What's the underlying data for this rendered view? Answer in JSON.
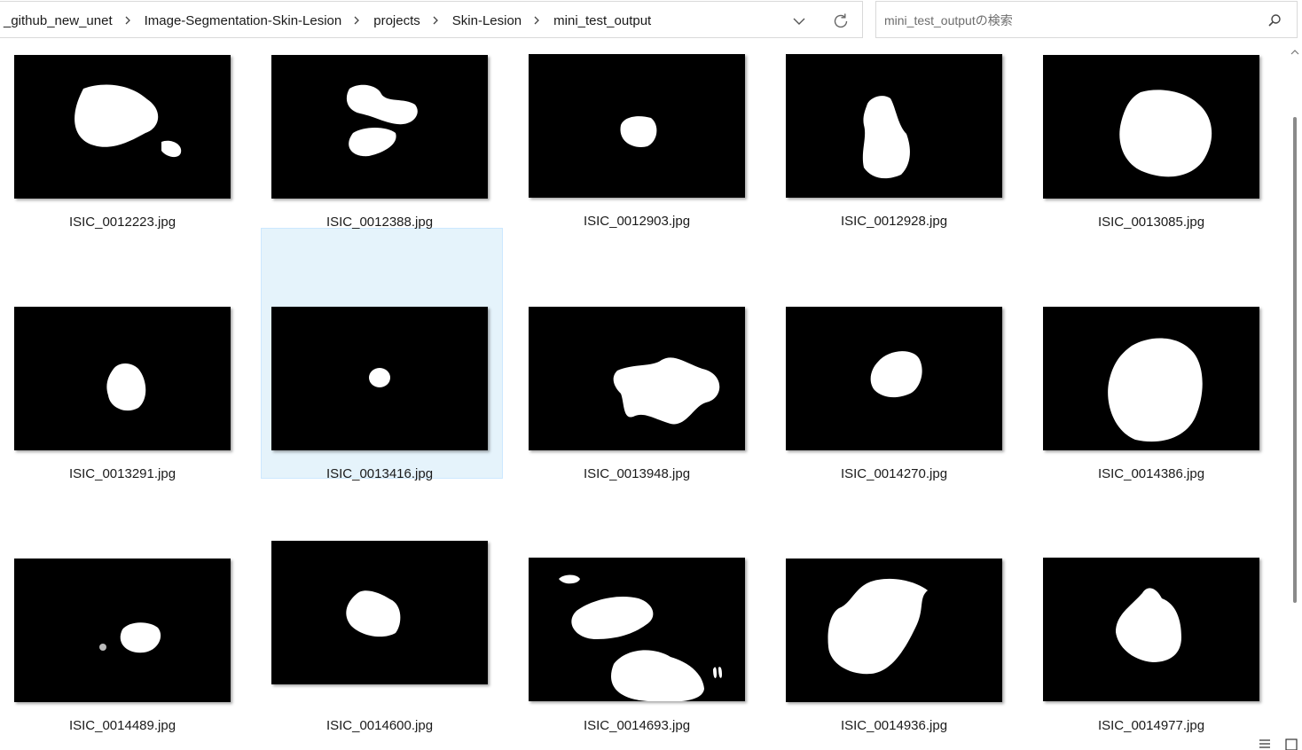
{
  "breadcrumb": {
    "items": [
      "_github_new_unet",
      "Image-Segmentation-Skin-Lesion",
      "projects",
      "Skin-Lesion",
      "mini_test_output"
    ]
  },
  "search": {
    "placeholder": "mini_test_outputの検索"
  },
  "files": [
    {
      "name": "ISIC_0012223.jpg"
    },
    {
      "name": "ISIC_0012388.jpg"
    },
    {
      "name": "ISIC_0012903.jpg"
    },
    {
      "name": "ISIC_0012928.jpg"
    },
    {
      "name": "ISIC_0013085.jpg"
    },
    {
      "name": "ISIC_0013291.jpg"
    },
    {
      "name": "ISIC_0013416.jpg"
    },
    {
      "name": "ISIC_0013948.jpg"
    },
    {
      "name": "ISIC_0014270.jpg"
    },
    {
      "name": "ISIC_0014386.jpg"
    },
    {
      "name": "ISIC_0014489.jpg"
    },
    {
      "name": "ISIC_0014600.jpg"
    },
    {
      "name": "ISIC_0014693.jpg"
    },
    {
      "name": "ISIC_0014936.jpg"
    },
    {
      "name": "ISIC_0014977.jpg"
    }
  ],
  "selected_file": "ISIC_0013416.jpg",
  "icons": [
    "chevron-right-icon",
    "chevron-down-icon",
    "refresh-icon",
    "search-icon",
    "details-view-icon",
    "large-icons-view-icon"
  ],
  "colors": {
    "selection_bg": "#e5f3fb",
    "thumb_bg": "#000000",
    "mask": "#ffffff"
  }
}
